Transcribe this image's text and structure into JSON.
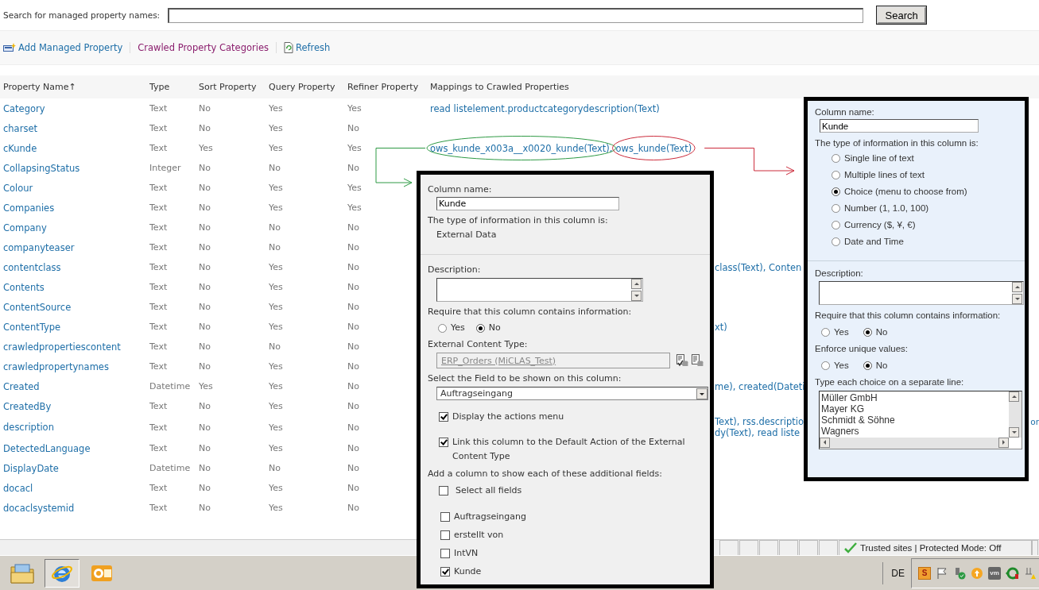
{
  "search": {
    "label": "Search for managed property names:",
    "button": "Search"
  },
  "toolbar": [
    {
      "label": "Add Managed Property",
      "visited": false
    },
    {
      "label": "Crawled Property Categories",
      "visited": true
    },
    {
      "label": "Refresh",
      "visited": false
    }
  ],
  "table": {
    "columns": [
      "Property Name↑",
      "Type",
      "Sort Property",
      "Query Property",
      "Refiner Property",
      "Mappings to Crawled Properties"
    ],
    "rows": [
      {
        "name": "Category",
        "type": "Text",
        "sort": "No",
        "query": "Yes",
        "refiner": "Yes",
        "mappings": [
          {
            "text": "read listelement.productcategorydescription(Text)"
          }
        ]
      },
      {
        "name": "charset",
        "type": "Text",
        "sort": "No",
        "query": "Yes",
        "refiner": "No"
      },
      {
        "name": "cKunde",
        "type": "Text",
        "sort": "Yes",
        "query": "Yes",
        "refiner": "Yes",
        "mappings": [
          {
            "text": "ows_kunde_x003a__x0020_kunde(Text),",
            "color": "#2e9a44"
          },
          {
            "text": "ows_kunde(Text)",
            "color": "#cc2b3b"
          }
        ]
      },
      {
        "name": "CollapsingStatus",
        "type": "Integer",
        "sort": "No",
        "query": "No",
        "refiner": "No"
      },
      {
        "name": "Colour",
        "type": "Text",
        "sort": "No",
        "query": "Yes",
        "refiner": "Yes"
      },
      {
        "name": "Companies",
        "type": "Text",
        "sort": "No",
        "query": "Yes",
        "refiner": "Yes"
      },
      {
        "name": "Company",
        "type": "Text",
        "sort": "No",
        "query": "No",
        "refiner": "No"
      },
      {
        "name": "companyteaser",
        "type": "Text",
        "sort": "No",
        "query": "No",
        "refiner": "No"
      },
      {
        "name": "contentclass",
        "type": "Text",
        "sort": "No",
        "query": "Yes",
        "refiner": "No",
        "mapping_right": [
          "class(Text), Conten"
        ]
      },
      {
        "name": "Contents",
        "type": "Text",
        "sort": "No",
        "query": "Yes",
        "refiner": "No"
      },
      {
        "name": "ContentSource",
        "type": "Text",
        "sort": "No",
        "query": "Yes",
        "refiner": "No"
      },
      {
        "name": "ContentType",
        "type": "Text",
        "sort": "No",
        "query": "Yes",
        "refiner": "No",
        "mapping_right": [
          "xt)"
        ]
      },
      {
        "name": "crawledpropertiescontent",
        "type": "Text",
        "sort": "No",
        "query": "No",
        "refiner": "No"
      },
      {
        "name": "crawledpropertynames",
        "type": "Text",
        "sort": "No",
        "query": "Yes",
        "refiner": "No"
      },
      {
        "name": "Created",
        "type": "Datetime",
        "sort": "Yes",
        "query": "Yes",
        "refiner": "No",
        "mapping_right": [
          "me), created(Dateti"
        ]
      },
      {
        "name": "CreatedBy",
        "type": "Text",
        "sort": "No",
        "query": "Yes",
        "refiner": "No"
      },
      {
        "name": "description",
        "type": "Text",
        "sort": "No",
        "query": "Yes",
        "refiner": "No",
        "mapping_right": [
          "Text), rss.descriptio",
          "dy(Text), read liste"
        ],
        "mapping_far_right": "or"
      },
      {
        "name": "DetectedLanguage",
        "type": "Text",
        "sort": "No",
        "query": "Yes",
        "refiner": "No"
      },
      {
        "name": "DisplayDate",
        "type": "Datetime",
        "sort": "No",
        "query": "No",
        "refiner": "No"
      },
      {
        "name": "docacl",
        "type": "Text",
        "sort": "No",
        "query": "Yes",
        "refiner": "No"
      },
      {
        "name": "docaclsystemid",
        "type": "Text",
        "sort": "No",
        "query": "Yes",
        "refiner": "No"
      }
    ]
  },
  "external_data_column": {
    "name_label": "Column name:",
    "name_value": "Kunde",
    "type_label": "The type of information in this column is:",
    "type_value": "External Data",
    "description_label": "Description:",
    "require_label": "Require that this column contains information:",
    "require_options": [
      {
        "label": "Yes",
        "selected": false
      },
      {
        "label": "No",
        "selected": true
      }
    ],
    "content_type_label": "External Content Type:",
    "content_type_value": "ERP_Orders (MiCLAS_Test)",
    "field_label": "Select the Field to be shown on this column:",
    "field_value": "Auftragseingang",
    "options": [
      {
        "label": "Display the actions menu",
        "checked": true
      },
      {
        "label": "Link this column to the Default Action of the External Content Type",
        "checked": true
      }
    ],
    "additional_label": "Add a column to show each of these additional fields:",
    "select_all": {
      "label": "Select all fields",
      "checked": false
    },
    "fields": [
      {
        "label": "Auftragseingang",
        "checked": false
      },
      {
        "label": "erstellt von",
        "checked": false
      },
      {
        "label": "IntVN",
        "checked": false
      },
      {
        "label": "Kunde",
        "checked": true
      }
    ]
  },
  "choice_column": {
    "name_label": "Column name:",
    "name_value": "Kunde",
    "type_label": "The type of information in this column is:",
    "types": [
      {
        "label": "Single line of text",
        "selected": false
      },
      {
        "label": "Multiple lines of text",
        "selected": false
      },
      {
        "label": "Choice (menu to choose from)",
        "selected": true
      },
      {
        "label": "Number (1, 1.0, 100)",
        "selected": false
      },
      {
        "label": "Currency ($, ¥, €)",
        "selected": false
      },
      {
        "label": "Date and Time",
        "selected": false
      }
    ],
    "description_label": "Description:",
    "require_label": "Require that this column contains information:",
    "require_options": [
      {
        "label": "Yes",
        "selected": false
      },
      {
        "label": "No",
        "selected": true
      }
    ],
    "unique_label": "Enforce unique values:",
    "unique_options": [
      {
        "label": "Yes",
        "selected": false
      },
      {
        "label": "No",
        "selected": true
      }
    ],
    "choices_label": "Type each choice on a separate line:",
    "choices": [
      "Müller GmbH",
      "Mayer KG",
      "Schmidt & Söhne",
      "Wagners"
    ]
  },
  "status_bar": {
    "zone": "Trusted sites | Protected Mode: Off"
  },
  "taskbar": {
    "language": "DE",
    "tray_badges": [
      "S",
      "vm"
    ]
  }
}
